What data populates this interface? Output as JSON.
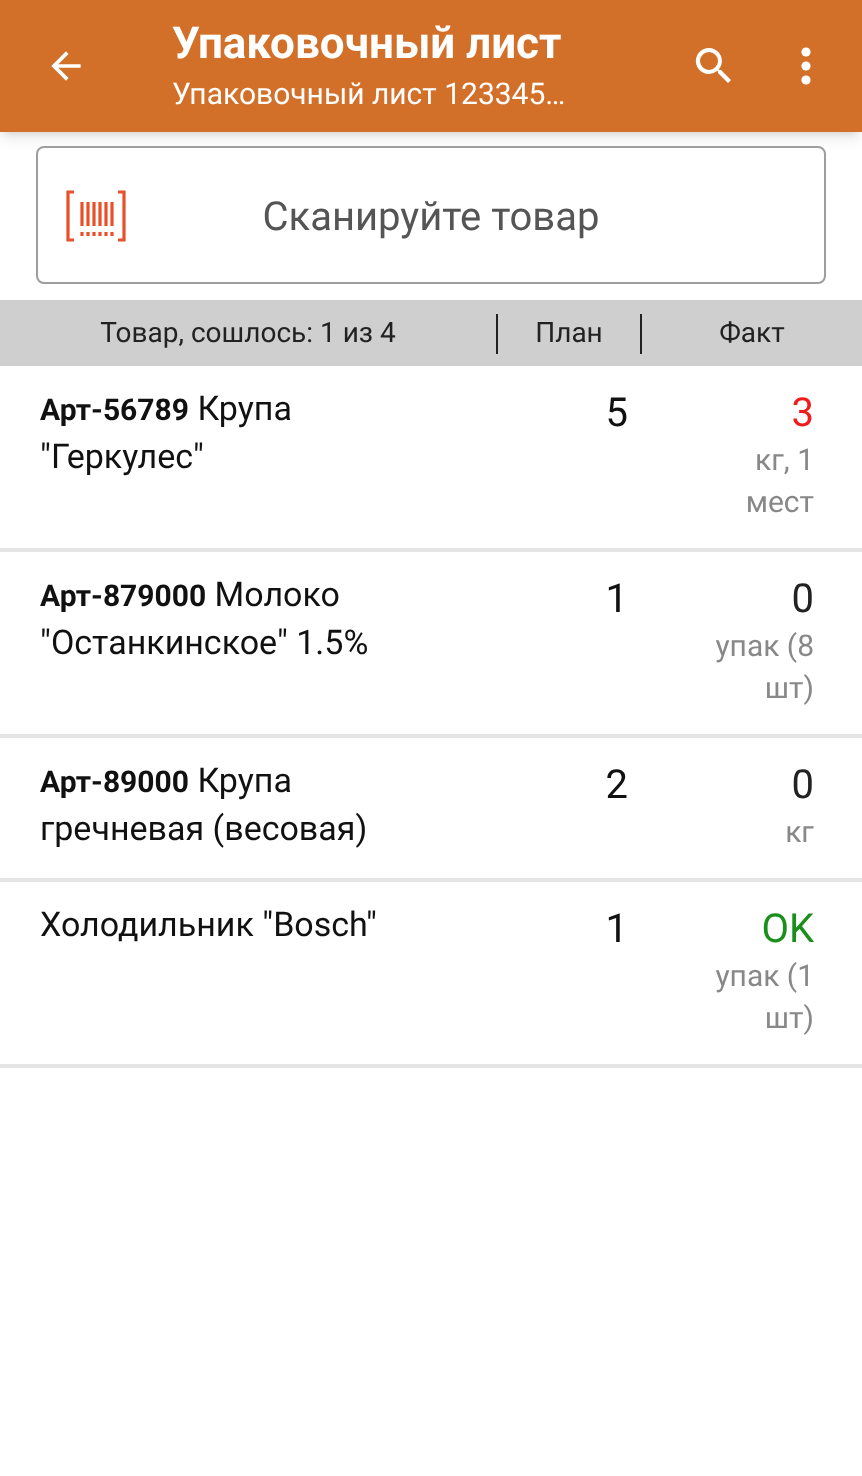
{
  "app_bar": {
    "title": "Упаковочный лист",
    "subtitle": "Упаковочный лист 123345…"
  },
  "scan_field": {
    "placeholder": "Сканируйте товар"
  },
  "table": {
    "columns": [
      "Товар, сошлось: 1 из 4",
      "План",
      "Факт"
    ],
    "rows": [
      {
        "name": "**Арт-56789** Крупа \"Геркулес\"",
        "plan": "5",
        "fact": "3",
        "unit": "кг, 1 мест",
        "kind": "short"
      },
      {
        "name": "**Арт-879000** Молоко \"Останкинское\" 1.5%",
        "plan": "1",
        "fact": "0",
        "unit": "упак (8 шт)",
        "kind": "plain"
      },
      {
        "name": "**Арт-89000** Крупа гречневая (весовая)",
        "plan": "2",
        "fact": "0",
        "unit": "кг",
        "kind": "plain"
      },
      {
        "name": "Холодильник \"Bosch\"",
        "plan": "1",
        "fact": "OK",
        "unit": "упак (1 шт)",
        "kind": "ok"
      }
    ]
  }
}
